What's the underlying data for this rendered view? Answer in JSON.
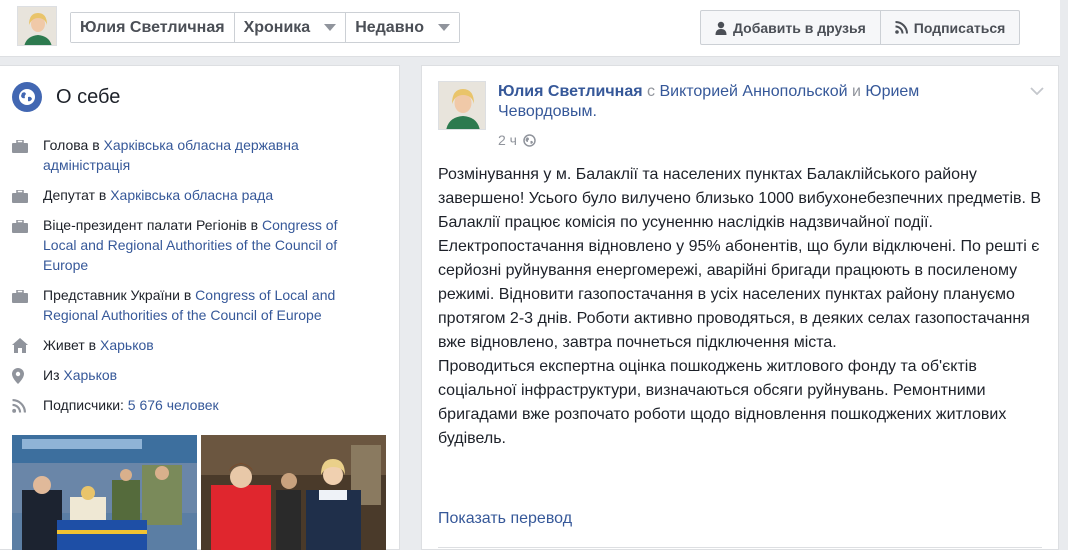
{
  "header": {
    "profile_name": "Юлия Светличная",
    "timeline_label": "Хроника",
    "recent_label": "Недавно",
    "add_friend_label": "Добавить в друзья",
    "follow_label": "Подписаться"
  },
  "about": {
    "title": "О себе",
    "items": [
      {
        "icon": "briefcase-icon",
        "prefix": "Голова в ",
        "link": "Харківська обласна державна адміністрація"
      },
      {
        "icon": "briefcase-icon",
        "prefix": "Депутат в ",
        "link": "Харківська обласна рада"
      },
      {
        "icon": "briefcase-icon",
        "prefix": "Віце-президент палати Регіонів в ",
        "link": "Congress of Local and Regional Authorities of the Council of Europe"
      },
      {
        "icon": "briefcase-icon",
        "prefix": "Представник України в ",
        "link": "Congress of Local and Regional Authorities of the Council of Europe"
      },
      {
        "icon": "home-icon",
        "prefix": "Живет в ",
        "link": "Харьков"
      },
      {
        "icon": "location-pin-icon",
        "prefix": "Из ",
        "link": "Харьков"
      },
      {
        "icon": "rss-icon",
        "prefix": "Подписчики: ",
        "link": "5 676 человек"
      }
    ]
  },
  "post": {
    "author": "Юлия Светличная",
    "with_word": "с",
    "tagged_1": "Викторией Аннопольской",
    "and_word": "и",
    "tagged_2": "Юрием Чевордовым.",
    "time": "2 ч",
    "paragraphs": [
      "Розмінування у м. Балаклії та населених пунктах Балаклійського району завершено! Усього було вилучено близько 1000 вибухонебезпечних предметів. В Балаклії працює комісія по усуненню наслідків надзвичайної події.",
      "Електропостачання відновлено у 95% абонентів, що були відключені. По решті є серйозні руйнування енергомережі, аварійні бригади працюють в посиленому режимі. Відновити газопостачання в усіх населених пунктах району плануємо протягом 2-3 днів. Роботи активно проводяться, в деяких селах газопостачання вже відновлено, завтра почнеться підключення міста.",
      "Проводиться експертна оцінка пошкоджень житлового фонду та об'єктів соціальної інфраструктури, визначаються обсяги руйнувань. Ремонтними бригадами вже розпочато роботи щодо відновлення пошкоджених житлових будівель."
    ],
    "translate_label": "Показать перевод"
  }
}
